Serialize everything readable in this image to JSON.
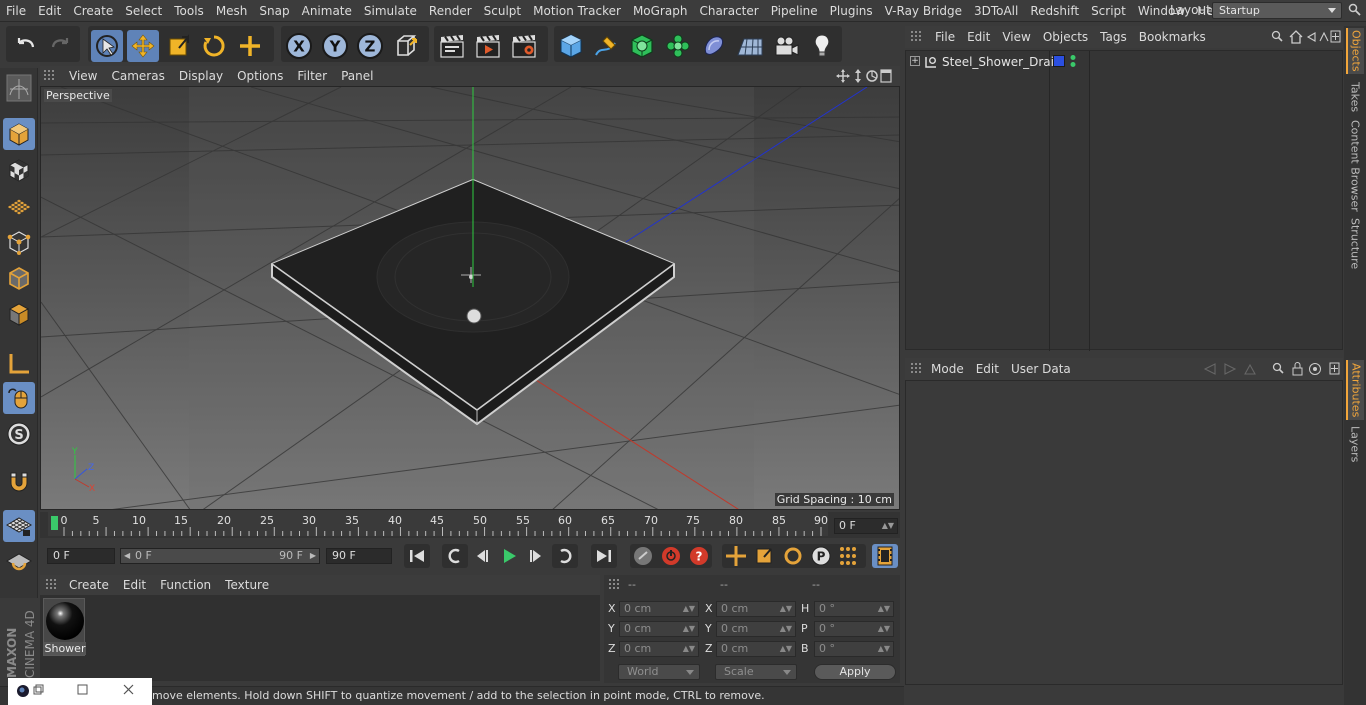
{
  "menubar": {
    "items": [
      "File",
      "Edit",
      "Create",
      "Select",
      "Tools",
      "Mesh",
      "Snap",
      "Animate",
      "Simulate",
      "Render",
      "Sculpt",
      "Motion Tracker",
      "MoGraph",
      "Character",
      "Pipeline",
      "Plugins",
      "V-Ray Bridge",
      "3DToAll",
      "Redshift",
      "Script",
      "Window",
      "Help"
    ],
    "layout_label": "Layout:",
    "layout_value": "Startup"
  },
  "viewport": {
    "menu": [
      "View",
      "Cameras",
      "Display",
      "Options",
      "Filter",
      "Panel"
    ],
    "camera_label": "Perspective",
    "grid_spacing": "Grid Spacing : 10 cm"
  },
  "timeline": {
    "ticks": [
      "0",
      "5",
      "10",
      "15",
      "20",
      "25",
      "30",
      "35",
      "40",
      "45",
      "50",
      "55",
      "60",
      "65",
      "70",
      "75",
      "80",
      "85",
      "90"
    ],
    "current_frame": "0 F"
  },
  "transport": {
    "start_field": "0 F",
    "range_start": "0 F",
    "range_end": "90 F",
    "end_field": "90 F"
  },
  "material_manager": {
    "menu": [
      "Create",
      "Edit",
      "Function",
      "Texture"
    ],
    "material_name": "Shower"
  },
  "coordinates": {
    "headers": [
      "--",
      "--",
      "--"
    ],
    "pos_labels": [
      "X",
      "Y",
      "Z"
    ],
    "pos_values": [
      "0 cm",
      "0 cm",
      "0 cm"
    ],
    "size_labels": [
      "X",
      "Y",
      "Z"
    ],
    "size_values": [
      "0 cm",
      "0 cm",
      "0 cm"
    ],
    "rot_labels": [
      "H",
      "P",
      "B"
    ],
    "rot_values": [
      "0 °",
      "0 °",
      "0 °"
    ],
    "world_dropdown": "World",
    "scale_dropdown": "Scale",
    "apply_label": "Apply"
  },
  "object_manager": {
    "menu": [
      "File",
      "Edit",
      "View",
      "Objects",
      "Tags",
      "Bookmarks"
    ],
    "object_name": "Steel_Shower_Drain"
  },
  "attributes": {
    "menu": [
      "Mode",
      "Edit",
      "User Data"
    ]
  },
  "right_tabs": {
    "top": [
      "Objects",
      "Takes",
      "Content Browser",
      "Structure"
    ],
    "bottom": [
      "Attributes",
      "Layers"
    ]
  },
  "status": {
    "text": "move elements. Hold down SHIFT to quantize movement / add to the selection in point mode, CTRL to remove."
  },
  "brand": {
    "maxon": "MAXON",
    "product": "CINEMA 4D"
  },
  "colors": {
    "accent_blue": "#5f83b8",
    "tab_orange": "#f2a63b",
    "axis_x": "#c0392b",
    "axis_y": "#2ecc40",
    "axis_z": "#2233cc"
  }
}
